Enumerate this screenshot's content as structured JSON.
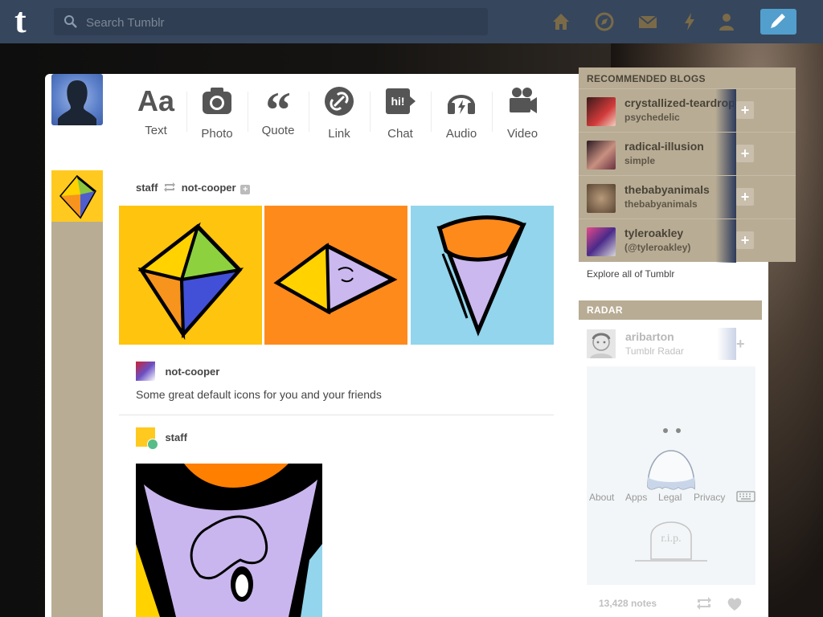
{
  "header": {
    "search_placeholder": "Search Tumblr",
    "nav_icons": [
      "home-icon",
      "explore-icon",
      "messages-icon",
      "activity-icon",
      "account-icon"
    ],
    "compose_icon": "pencil-icon",
    "brand_color": "#36465d",
    "accent_color": "#529ecc"
  },
  "post_types": [
    {
      "label": "Text",
      "icon": "Aa"
    },
    {
      "label": "Photo",
      "icon": "camera-icon"
    },
    {
      "label": "Quote",
      "icon": "quote-icon"
    },
    {
      "label": "Link",
      "icon": "link-icon"
    },
    {
      "label": "Chat",
      "icon": "hi!"
    },
    {
      "label": "Audio",
      "icon": "headphones-icon"
    },
    {
      "label": "Video",
      "icon": "video-camera-icon"
    }
  ],
  "post": {
    "author": "staff",
    "reblogged_from": "not-cooper",
    "caption_author": "not-cooper",
    "caption": "Some great default icons for you and your friends",
    "reblog_author": "staff"
  },
  "recommended": {
    "title": "RECOMMENDED BLOGS",
    "blogs": [
      {
        "name": "crystallized-teardrops",
        "sub": "psychedelic"
      },
      {
        "name": "radical-illusion",
        "sub": "simple"
      },
      {
        "name": "thebabyanimals",
        "sub": "thebabyanimals"
      },
      {
        "name": "tyleroakley",
        "sub": "(@tyleroakley)"
      }
    ],
    "explore": "Explore all of Tumblr"
  },
  "radar": {
    "title": "RADAR",
    "name": "aribarton",
    "sub": "Tumblr Radar",
    "notes": "13,428 notes"
  },
  "footer": [
    "About",
    "Apps",
    "Legal",
    "Privacy"
  ]
}
